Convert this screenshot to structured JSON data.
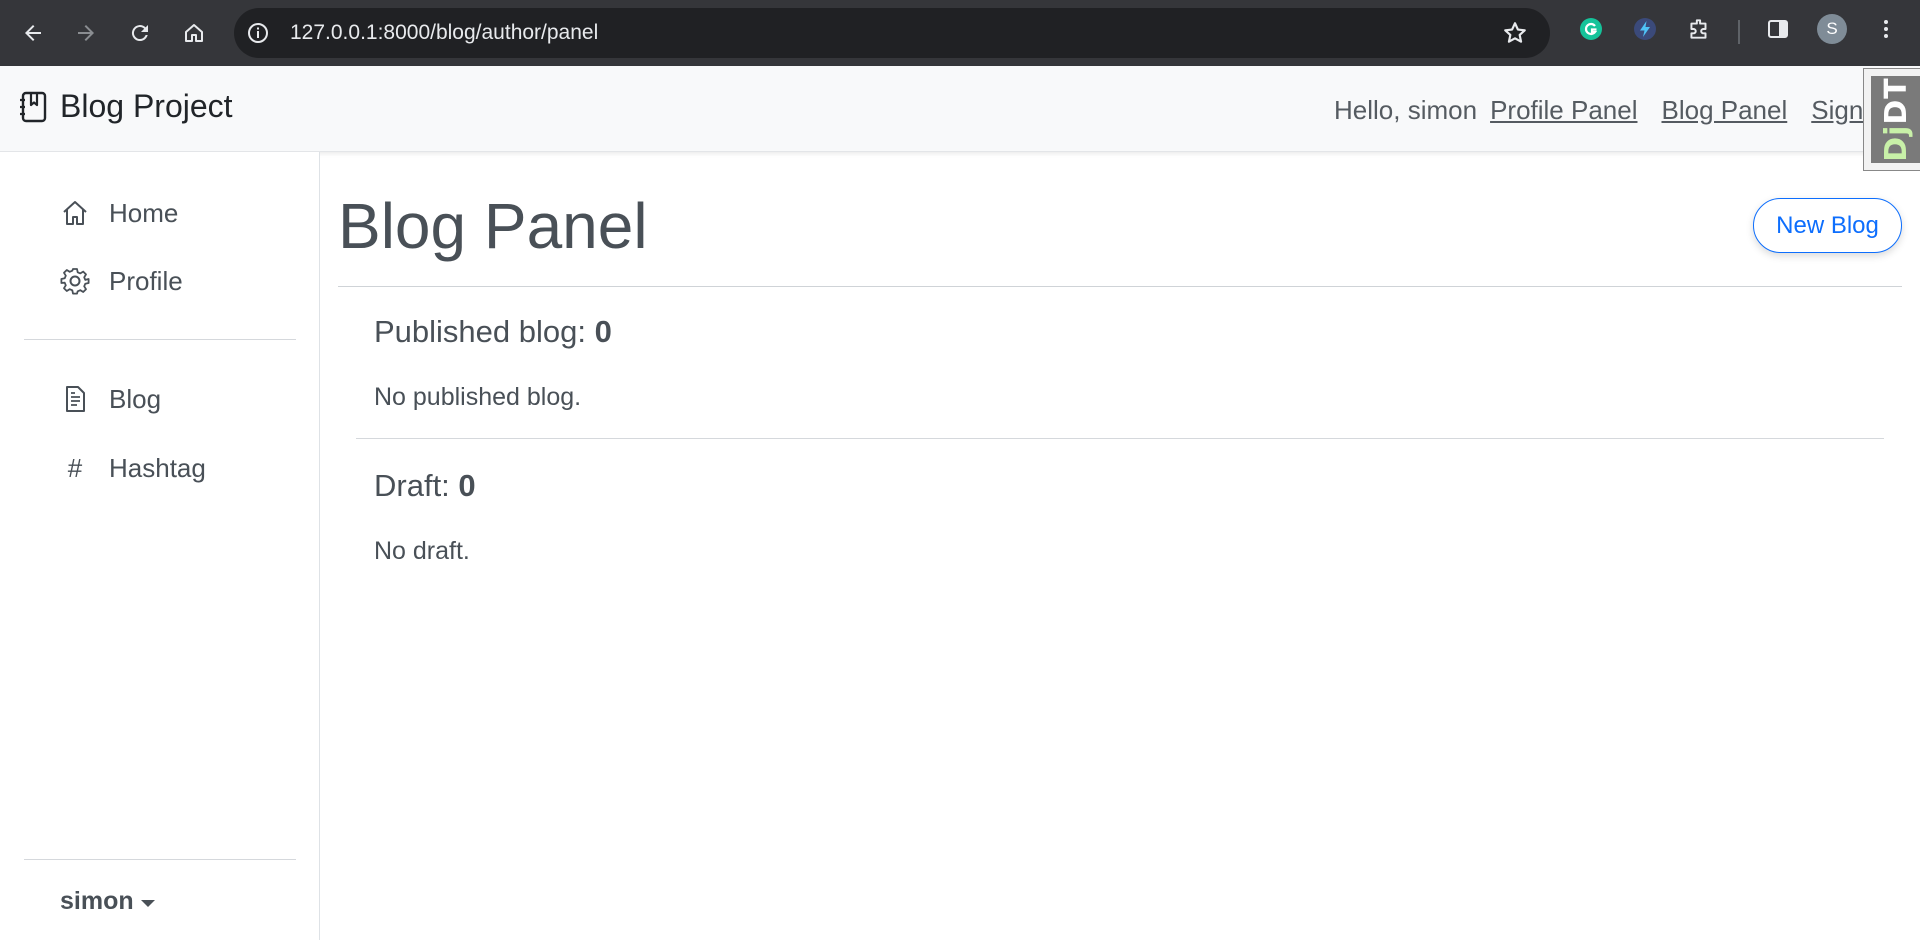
{
  "browser": {
    "url": "127.0.0.1:8000/blog/author/panel",
    "profile_initial": "S",
    "extensions": [
      "grammarly-icon",
      "lightning-extension-icon",
      "puzzle-icon"
    ]
  },
  "navbar": {
    "brand": "Blog Project",
    "greeting": "Hello, simon",
    "links": [
      "Profile Panel",
      "Blog Panel",
      "Signout"
    ],
    "debug_toolbar": {
      "prefix": "Dj",
      "suffix": "DT"
    }
  },
  "sidebar": {
    "items": [
      {
        "label": "Home",
        "icon": "home-icon"
      },
      {
        "label": "Profile",
        "icon": "gear-icon"
      },
      {
        "label": "Blog",
        "icon": "document-icon"
      },
      {
        "label": "Hashtag",
        "icon": "hash-icon",
        "glyph": "#"
      }
    ],
    "user": "simon"
  },
  "main": {
    "title": "Blog Panel",
    "new_blog_label": "New Blog",
    "sections": [
      {
        "label": "Published blog: ",
        "count": "0",
        "empty_text": "No published blog."
      },
      {
        "label": "Draft: ",
        "count": "0",
        "empty_text": "No draft."
      }
    ]
  },
  "colors": {
    "chrome_bg": "#35363a",
    "omnibox_bg": "#202124",
    "navbar_bg": "#f8f9fa",
    "primary": "#0d6efd",
    "text": "#495057"
  }
}
